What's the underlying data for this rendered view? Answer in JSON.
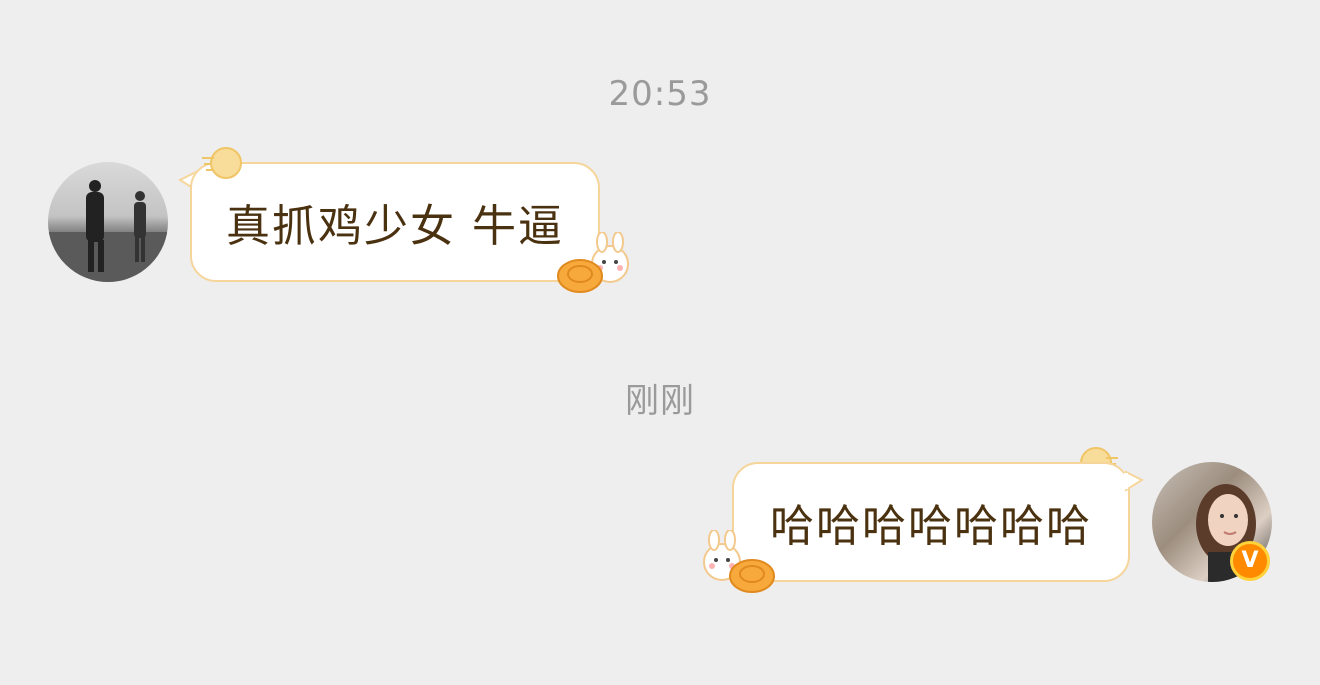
{
  "chat": {
    "timestamp_1": "20:53",
    "timestamp_2": "刚刚",
    "messages": [
      {
        "sender": "other",
        "text": "真抓鸡少女 牛逼"
      },
      {
        "sender": "self",
        "text": "哈哈哈哈哈哈哈"
      }
    ],
    "self_badge": "V"
  },
  "colors": {
    "background": "#eeeeee",
    "bubble_border": "#f6d59b",
    "message_text": "#4a3110",
    "timestamp_text": "#9a9a9a",
    "badge": "#ff8a00"
  },
  "icons": [
    "moon-icon",
    "rabbit-mooncake-icon",
    "verified-badge-icon"
  ]
}
